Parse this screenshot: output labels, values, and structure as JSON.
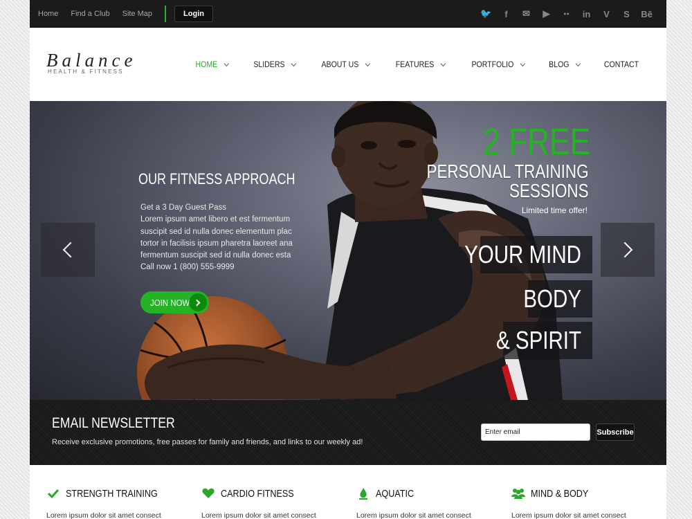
{
  "topbar": {
    "links": [
      "Home",
      "Find a Club",
      "Site Map"
    ],
    "login_label": "Login",
    "social_icons": [
      "twitter-icon",
      "facebook-icon",
      "mail-icon",
      "youtube-icon",
      "flickr-icon",
      "linkedin-icon",
      "vimeo-icon",
      "skype-icon",
      "behance-icon"
    ],
    "social_glyphs": [
      "🐦",
      "f",
      "✉",
      "▶",
      "●●",
      "in",
      "V",
      "S",
      "Bē"
    ]
  },
  "header": {
    "logo_main": "Balance",
    "logo_sub": "HEALTH & FITNESS",
    "nav": [
      {
        "label": "HOME",
        "active": true,
        "has_dropdown": true
      },
      {
        "label": "SLIDERS",
        "active": false,
        "has_dropdown": true
      },
      {
        "label": "ABOUT US",
        "active": false,
        "has_dropdown": true
      },
      {
        "label": "FEATURES",
        "active": false,
        "has_dropdown": true
      },
      {
        "label": "PORTFOLIO",
        "active": false,
        "has_dropdown": true
      },
      {
        "label": "BLOG",
        "active": false,
        "has_dropdown": true
      },
      {
        "label": "CONTACT",
        "active": false,
        "has_dropdown": false
      }
    ]
  },
  "hero": {
    "approach_title": "OUR FITNESS APPROACH",
    "approach_lines": [
      "Get a 3 Day Guest Pass",
      "Lorem ipsum amet libero et est fermentum",
      "suscipit sed id nulla donec elementum plac",
      "tortor in facilisis ipsum pharetra laoreet ana",
      "fermentum suscipit sed id nulla donec esta",
      "Call now 1 (800) 555-9999"
    ],
    "join_label": "JOIN NOW!",
    "free_big": "2 FREE",
    "free_line1": "PERSONAL TRAINING",
    "free_line2": "SESSIONS",
    "free_note": "Limited time offer!",
    "mind_boxes": [
      "YOUR MIND",
      "BODY",
      "& SPIRIT"
    ]
  },
  "newsletter": {
    "title": "EMAIL NEWSLETTER",
    "text": "Receive exclusive promotions, free passes for family and friends, and links to our weekly ad!",
    "placeholder": "Enter email",
    "subscribe_label": "Subscribe"
  },
  "features": [
    {
      "title": "STRENGTH TRAINING",
      "icon": "checkmark-icon",
      "text": "Lorem ipsum dolor sit amet consect"
    },
    {
      "title": "CARDIO FITNESS",
      "icon": "heart-icon",
      "text": "Lorem ipsum dolor sit amet consect"
    },
    {
      "title": "AQUATIC",
      "icon": "water-drop-icon",
      "text": "Lorem ipsum dolor sit amet consect"
    },
    {
      "title": "MIND & BODY",
      "icon": "group-icon",
      "text": "Lorem ipsum dolor sit amet consect"
    }
  ],
  "colors": {
    "accent": "#2aa82a",
    "topbar": "#1b1b1b",
    "newsletter": "#1d1d1d"
  }
}
